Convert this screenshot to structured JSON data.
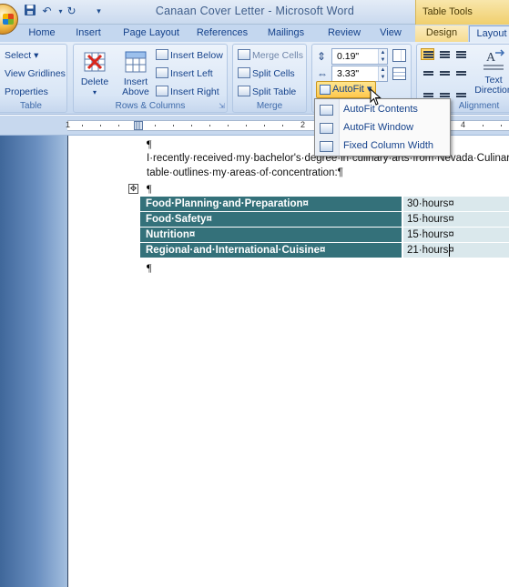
{
  "window": {
    "title": "Canaan Cover Letter - Microsoft Word",
    "context_tab_group": "Table Tools"
  },
  "quick_access": {
    "icons": [
      "save-icon",
      "undo-icon",
      "redo-icon",
      "customize-icon"
    ]
  },
  "tabs": [
    {
      "label": "Home"
    },
    {
      "label": "Insert"
    },
    {
      "label": "Page Layout"
    },
    {
      "label": "References"
    },
    {
      "label": "Mailings"
    },
    {
      "label": "Review"
    },
    {
      "label": "View"
    },
    {
      "label": "Design"
    },
    {
      "label": "Layout"
    }
  ],
  "ribbon": {
    "table_group": {
      "label": "Table",
      "select": "Select ▾",
      "view_gridlines": "View Gridlines",
      "properties": "Properties"
    },
    "rows_columns_group": {
      "label": "Rows & Columns",
      "delete": "Delete",
      "insert_above": "Insert\nAbove",
      "insert_above_1": "Insert",
      "insert_above_2": "Above",
      "insert_below": "Insert Below",
      "insert_left": "Insert Left",
      "insert_right": "Insert Right"
    },
    "merge_group": {
      "label": "Merge",
      "merge_cells": "Merge Cells",
      "split_cells": "Split Cells",
      "split_table": "Split Table"
    },
    "cell_size_group": {
      "height_value": "0.19\"",
      "width_value": "3.33\"",
      "autofit": "AutoFit ▾"
    },
    "alignment_group": {
      "label": "Alignment",
      "text_direction_1": "Text",
      "text_direction_2": "Direction"
    }
  },
  "ruler": {
    "numbers": [
      "1",
      "2",
      "3",
      "4"
    ]
  },
  "autofit_menu": [
    {
      "label": "AutoFit Contents"
    },
    {
      "label": "AutoFit Window"
    },
    {
      "label": "Fixed Column Width"
    }
  ],
  "document": {
    "pilcrow": "¶",
    "line1": "I·recently·received·my·bachelor's·degree·in·culinary·arts·from·Nevada·Culinary·Institute.·The·following",
    "line2": "table·outlines·my·areas·of·concentration:¶",
    "table": {
      "rows": [
        {
          "subject": "Food·Planning·and·Preparation¤",
          "hours": "30·hours¤"
        },
        {
          "subject": "Food·Safety¤",
          "hours": "15·hours¤"
        },
        {
          "subject": "Nutrition¤",
          "hours": "15·hours¤"
        },
        {
          "subject": "Regional·and·International·Cuisine¤",
          "hours": "21·hours¤"
        }
      ]
    }
  },
  "colors": {
    "table_header_fill": "#34717a",
    "table_value_fill": "#dae8ec",
    "autofit_highlight": "#ffc84d",
    "context_tab": "#f6dc90"
  }
}
